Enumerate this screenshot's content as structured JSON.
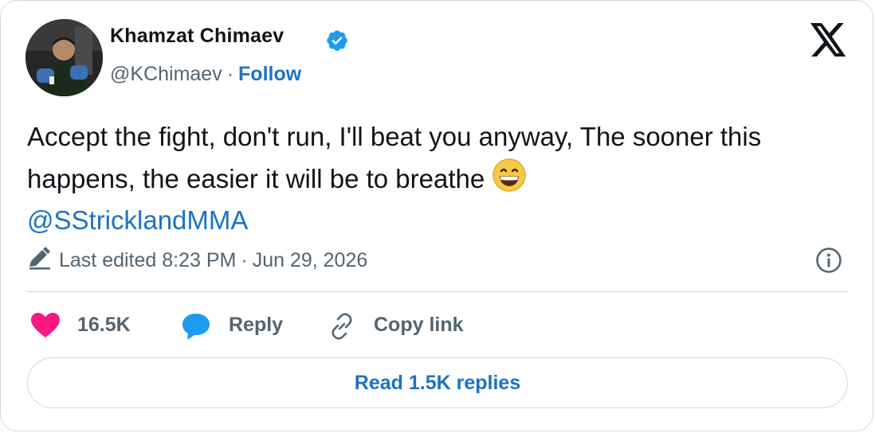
{
  "author": {
    "name": "Khamzat Chimaev",
    "handle": "@KChimaev",
    "separator": "·",
    "follow_label": "Follow",
    "verified_icon": "verified-badge-icon",
    "avatar_icon": "profile-photo"
  },
  "platform_icon": "x-logo-icon",
  "tweet": {
    "text": "Accept the fight, don't run, I'll beat you anyway, The sooner this happens, the easier it will be to breathe",
    "emoji_icon": "grinning-face-emoji",
    "mention": "@SStricklandMMA"
  },
  "meta": {
    "edited_icon": "pencil-icon",
    "edited_text": "Last edited 8:23 PM",
    "separator": "·",
    "date": "Jun 29, 2026",
    "info_icon": "info-icon"
  },
  "actions": {
    "likes": {
      "icon": "heart-icon",
      "label": "16.5K"
    },
    "reply": {
      "icon": "reply-bubble-icon",
      "label": "Reply"
    },
    "copy_link": {
      "icon": "link-icon",
      "label": "Copy link"
    }
  },
  "read_replies_label": "Read 1.5K replies",
  "colors": {
    "accent": "#1d72c5",
    "heart": "#f91880",
    "reply_icon": "#1d9bf0",
    "muted_text": "#536471",
    "border": "#cfd9de",
    "verified": "#1d9bf0"
  }
}
